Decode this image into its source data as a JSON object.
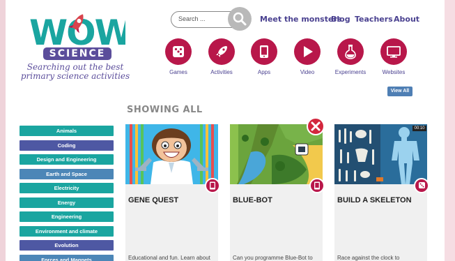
{
  "logo": {
    "wow": "WOW",
    "science": "SCIENCE",
    "tagline_line1": "Searching out the best",
    "tagline_line2": "primary science activities"
  },
  "search": {
    "placeholder": "Search ..."
  },
  "nav": [
    {
      "label": "Meet the monsters"
    },
    {
      "label": "Blog"
    },
    {
      "label": "Teachers"
    },
    {
      "label": "About"
    }
  ],
  "categories": [
    {
      "label": "Games",
      "icon": "dice-icon"
    },
    {
      "label": "Activities",
      "icon": "rocket-icon"
    },
    {
      "label": "Apps",
      "icon": "tablet-icon"
    },
    {
      "label": "Video",
      "icon": "play-icon"
    },
    {
      "label": "Experiments",
      "icon": "flask-icon"
    },
    {
      "label": "Websites",
      "icon": "monitor-icon"
    }
  ],
  "view_all": "View All",
  "showing": "SHOWING ALL",
  "sidebar": [
    {
      "label": "Animals"
    },
    {
      "label": "Coding"
    },
    {
      "label": "Design and Engineering"
    },
    {
      "label": "Earth and Space"
    },
    {
      "label": "Electricity"
    },
    {
      "label": "Energy"
    },
    {
      "label": "Engineering"
    },
    {
      "label": "Environment and climate"
    },
    {
      "label": "Evolution"
    },
    {
      "label": "Forces and Magnets"
    }
  ],
  "cards": [
    {
      "title": "GENE QUEST",
      "desc": "Educational and fun. Learn about",
      "icon": "tablet-icon"
    },
    {
      "title": "BLUE-BOT",
      "desc": "Can you programme Blue-Bot to",
      "icon": "tablet-icon"
    },
    {
      "title": "BUILD A SKELETON",
      "desc": "Race against the clock to",
      "icon": "dice-icon",
      "timer": "00:10"
    }
  ],
  "colors": {
    "brand_purple": "#5b4d9b",
    "accent_magenta": "#b8174a",
    "teal": "#1aa5a0",
    "navy": "#4e58a3",
    "steel": "#4c86b7"
  }
}
